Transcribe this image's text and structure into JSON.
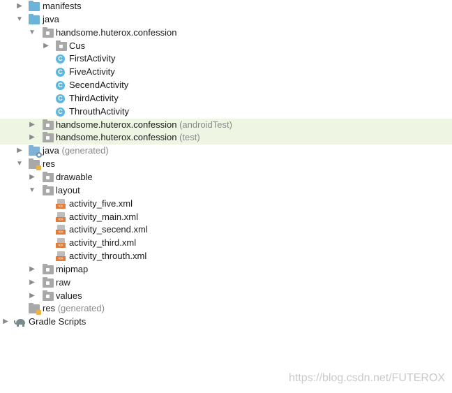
{
  "tree": {
    "manifests": "manifests",
    "java": "java",
    "pkg_main": "handsome.huterox.confession",
    "cus": "Cus",
    "first": "FirstActivity",
    "five": "FiveActivity",
    "secend": "SecendActivity",
    "third": "ThirdActivity",
    "throuth": "ThrouthActivity",
    "pkg_android_test": "handsome.huterox.confession",
    "android_test_suffix": "(androidTest)",
    "pkg_test": "handsome.huterox.confession",
    "test_suffix": "(test)",
    "java_generated": "java",
    "java_generated_suffix": "(generated)",
    "res": "res",
    "drawable": "drawable",
    "layout": "layout",
    "xml_five": "activity_five.xml",
    "xml_main": "activity_main.xml",
    "xml_secend": "activity_secend.xml",
    "xml_third": "activity_third.xml",
    "xml_throuth": "activity_throuth.xml",
    "mipmap": "mipmap",
    "raw": "raw",
    "values": "values",
    "res_generated": "res",
    "res_generated_suffix": "(generated)",
    "gradle": "Gradle Scripts"
  },
  "icons": {
    "expanded_arrow": "▼",
    "collapsed_arrow": "▶",
    "class_letter": "C",
    "xml_tag": "<>"
  },
  "colors": {
    "highlight_row": "#eef5e3",
    "class_icon": "#5cb8e0",
    "xml_tag": "#e07b39",
    "muted_text": "#8a8a8a"
  },
  "watermark": "https://blog.csdn.net/FUTEROX"
}
